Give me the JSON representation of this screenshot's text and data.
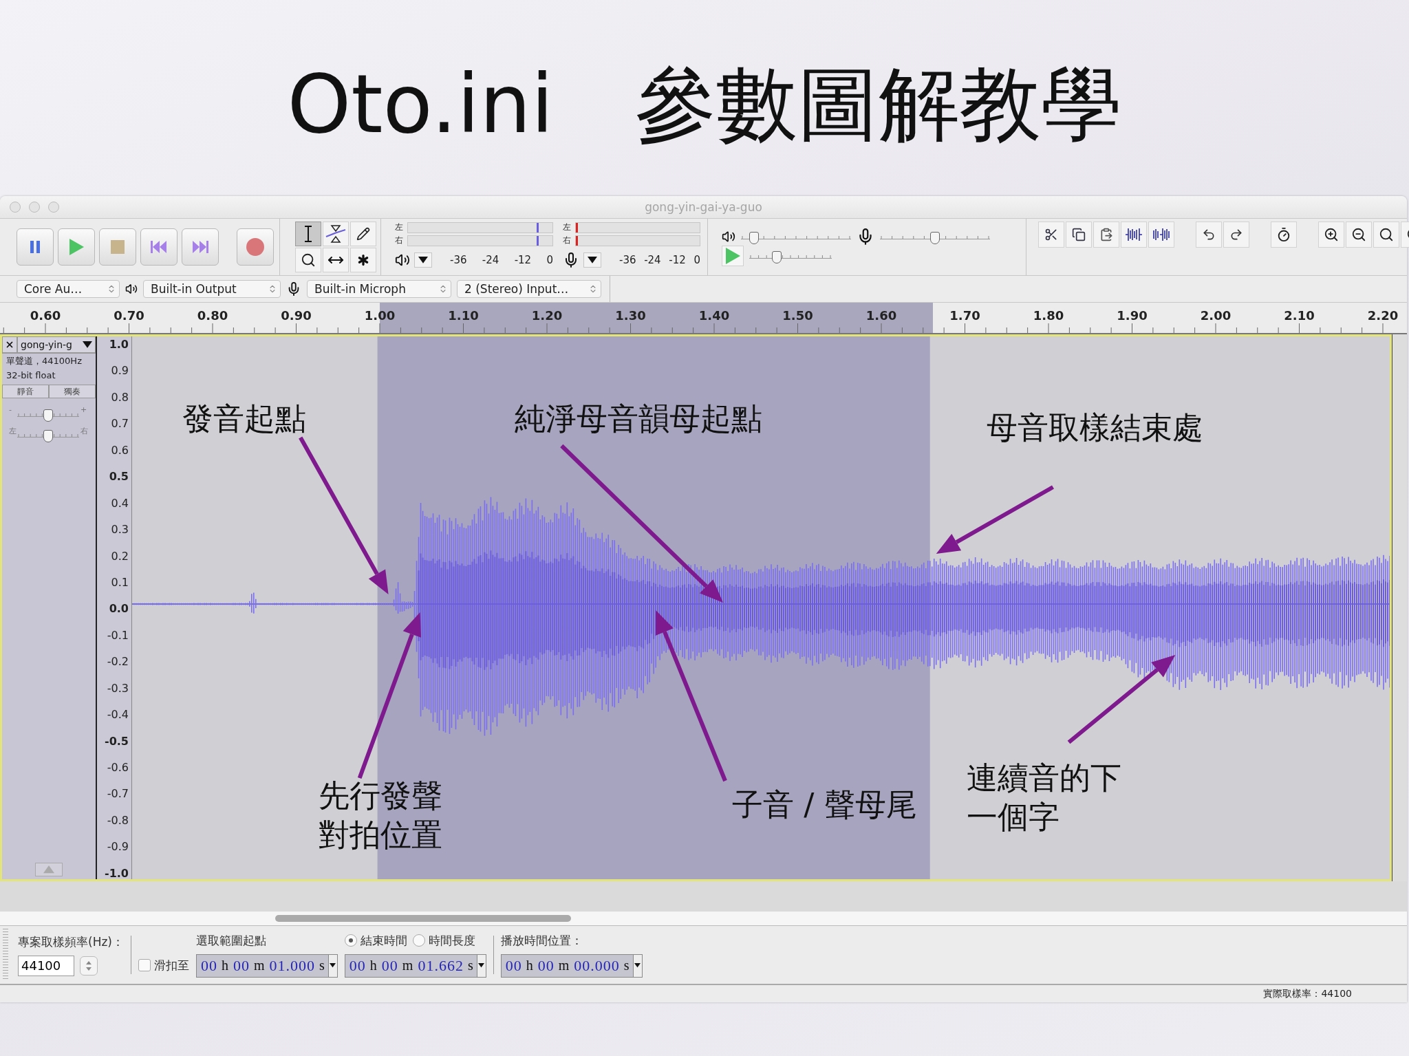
{
  "slide_title": "Oto.ini　參數圖解教學",
  "window": {
    "title": "gong-yin-gai-ya-guo"
  },
  "tools": [
    {
      "kind": "select",
      "selected": true
    },
    {
      "kind": "envelope",
      "selected": false
    },
    {
      "kind": "draw",
      "selected": false
    },
    {
      "kind": "zoom",
      "selected": false
    },
    {
      "kind": "timeshift",
      "selected": false
    },
    {
      "kind": "multi",
      "selected": false
    }
  ],
  "meters": [
    {
      "kind": "playback",
      "left": "左",
      "right": "右",
      "level": 0.92,
      "scale": [
        "-36",
        "-24",
        "-12",
        "0"
      ]
    },
    {
      "kind": "recording",
      "left": "左",
      "right": "右",
      "level": 0.0,
      "scale": [
        "-36",
        "-24",
        "-12",
        "0"
      ]
    }
  ],
  "mixer": {
    "output_volume": {
      "level": 0.12
    },
    "input_volume": {
      "level": 0.5
    },
    "play_speed": {
      "level": 0.33
    }
  },
  "devices": {
    "host": "Core Au…",
    "output": "Built-in Output",
    "input": "Built-in Microph",
    "channels": "2 (Stereo) Input…"
  },
  "timeline": {
    "ticks": [
      "0.60",
      "0.70",
      "0.80",
      "0.90",
      "1.00",
      "1.10",
      "1.20",
      "1.30",
      "1.40",
      "1.50",
      "1.60",
      "1.70",
      "1.80",
      "1.90",
      "2.00",
      "2.10",
      "2.20"
    ]
  },
  "track": {
    "name": "gong-yin-g",
    "info": [
      "單聲道，44100Hz",
      "32-bit float"
    ],
    "buttons": [
      {
        "label": "靜音",
        "selected": false
      },
      {
        "label": "獨奏",
        "selected": false
      }
    ],
    "gain": {
      "minus": "-",
      "plus": "+",
      "level": 0.5
    },
    "pan": {
      "left": "左",
      "right": "右",
      "level": 0.5
    }
  },
  "amplitude_ticks": [
    "1.0",
    "0.9",
    "0.8",
    "0.7",
    "0.6",
    "0.5",
    "0.4",
    "0.3",
    "0.2",
    "0.1",
    "0.0",
    "-0.1",
    "-0.2",
    "-0.3",
    "-0.4",
    "-0.5",
    "-0.6",
    "-0.7",
    "-0.8",
    "-0.9",
    "-1.0"
  ],
  "annotations": [
    {
      "lines": [
        "發音起點"
      ]
    },
    {
      "lines": [
        "純淨母音韻母起點"
      ]
    },
    {
      "lines": [
        "母音取樣結束處"
      ]
    },
    {
      "lines": [
        "先行發聲",
        "對拍位置"
      ]
    },
    {
      "lines": [
        "子音 / 聲母尾"
      ]
    },
    {
      "lines": [
        "連續音的下",
        "一個字"
      ]
    }
  ],
  "selection_bar": {
    "rate_label": "專案取樣頻率(Hz)：",
    "rate": "44100",
    "snap": {
      "label": "滑扣至",
      "checked": false
    },
    "start_label": "選取範圍起點",
    "end_options": [
      {
        "label": "結束時間",
        "selected": true
      },
      {
        "label": "時間長度",
        "selected": false
      }
    ],
    "position_label": "播放時間位置：",
    "times": [
      {
        "parts": [
          "00",
          "h",
          "00",
          "m",
          "01.000",
          "s"
        ]
      },
      {
        "parts": [
          "00",
          "h",
          "00",
          "m",
          "01.662",
          "s"
        ]
      },
      {
        "parts": [
          "00",
          "h",
          "00",
          "m",
          "00.000",
          "s"
        ]
      }
    ]
  },
  "status": "實際取樣率：44100"
}
